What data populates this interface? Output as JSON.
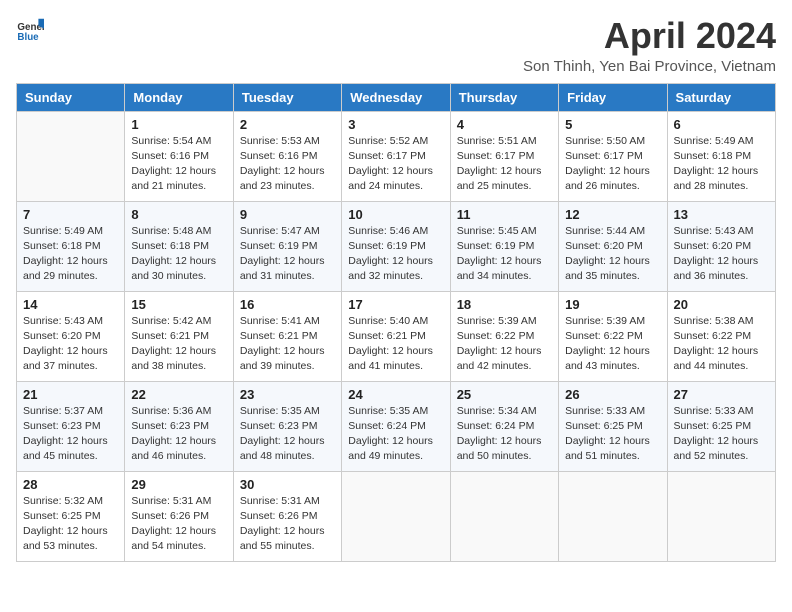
{
  "logo": {
    "line1": "General",
    "line2": "Blue"
  },
  "title": "April 2024",
  "subtitle": "Son Thinh, Yen Bai Province, Vietnam",
  "days_of_week": [
    "Sunday",
    "Monday",
    "Tuesday",
    "Wednesday",
    "Thursday",
    "Friday",
    "Saturday"
  ],
  "weeks": [
    [
      {
        "day": "",
        "info": ""
      },
      {
        "day": "1",
        "info": "Sunrise: 5:54 AM\nSunset: 6:16 PM\nDaylight: 12 hours and 21 minutes."
      },
      {
        "day": "2",
        "info": "Sunrise: 5:53 AM\nSunset: 6:16 PM\nDaylight: 12 hours and 23 minutes."
      },
      {
        "day": "3",
        "info": "Sunrise: 5:52 AM\nSunset: 6:17 PM\nDaylight: 12 hours and 24 minutes."
      },
      {
        "day": "4",
        "info": "Sunrise: 5:51 AM\nSunset: 6:17 PM\nDaylight: 12 hours and 25 minutes."
      },
      {
        "day": "5",
        "info": "Sunrise: 5:50 AM\nSunset: 6:17 PM\nDaylight: 12 hours and 26 minutes."
      },
      {
        "day": "6",
        "info": "Sunrise: 5:49 AM\nSunset: 6:18 PM\nDaylight: 12 hours and 28 minutes."
      }
    ],
    [
      {
        "day": "7",
        "info": "Sunrise: 5:49 AM\nSunset: 6:18 PM\nDaylight: 12 hours and 29 minutes."
      },
      {
        "day": "8",
        "info": "Sunrise: 5:48 AM\nSunset: 6:18 PM\nDaylight: 12 hours and 30 minutes."
      },
      {
        "day": "9",
        "info": "Sunrise: 5:47 AM\nSunset: 6:19 PM\nDaylight: 12 hours and 31 minutes."
      },
      {
        "day": "10",
        "info": "Sunrise: 5:46 AM\nSunset: 6:19 PM\nDaylight: 12 hours and 32 minutes."
      },
      {
        "day": "11",
        "info": "Sunrise: 5:45 AM\nSunset: 6:19 PM\nDaylight: 12 hours and 34 minutes."
      },
      {
        "day": "12",
        "info": "Sunrise: 5:44 AM\nSunset: 6:20 PM\nDaylight: 12 hours and 35 minutes."
      },
      {
        "day": "13",
        "info": "Sunrise: 5:43 AM\nSunset: 6:20 PM\nDaylight: 12 hours and 36 minutes."
      }
    ],
    [
      {
        "day": "14",
        "info": "Sunrise: 5:43 AM\nSunset: 6:20 PM\nDaylight: 12 hours and 37 minutes."
      },
      {
        "day": "15",
        "info": "Sunrise: 5:42 AM\nSunset: 6:21 PM\nDaylight: 12 hours and 38 minutes."
      },
      {
        "day": "16",
        "info": "Sunrise: 5:41 AM\nSunset: 6:21 PM\nDaylight: 12 hours and 39 minutes."
      },
      {
        "day": "17",
        "info": "Sunrise: 5:40 AM\nSunset: 6:21 PM\nDaylight: 12 hours and 41 minutes."
      },
      {
        "day": "18",
        "info": "Sunrise: 5:39 AM\nSunset: 6:22 PM\nDaylight: 12 hours and 42 minutes."
      },
      {
        "day": "19",
        "info": "Sunrise: 5:39 AM\nSunset: 6:22 PM\nDaylight: 12 hours and 43 minutes."
      },
      {
        "day": "20",
        "info": "Sunrise: 5:38 AM\nSunset: 6:22 PM\nDaylight: 12 hours and 44 minutes."
      }
    ],
    [
      {
        "day": "21",
        "info": "Sunrise: 5:37 AM\nSunset: 6:23 PM\nDaylight: 12 hours and 45 minutes."
      },
      {
        "day": "22",
        "info": "Sunrise: 5:36 AM\nSunset: 6:23 PM\nDaylight: 12 hours and 46 minutes."
      },
      {
        "day": "23",
        "info": "Sunrise: 5:35 AM\nSunset: 6:23 PM\nDaylight: 12 hours and 48 minutes."
      },
      {
        "day": "24",
        "info": "Sunrise: 5:35 AM\nSunset: 6:24 PM\nDaylight: 12 hours and 49 minutes."
      },
      {
        "day": "25",
        "info": "Sunrise: 5:34 AM\nSunset: 6:24 PM\nDaylight: 12 hours and 50 minutes."
      },
      {
        "day": "26",
        "info": "Sunrise: 5:33 AM\nSunset: 6:25 PM\nDaylight: 12 hours and 51 minutes."
      },
      {
        "day": "27",
        "info": "Sunrise: 5:33 AM\nSunset: 6:25 PM\nDaylight: 12 hours and 52 minutes."
      }
    ],
    [
      {
        "day": "28",
        "info": "Sunrise: 5:32 AM\nSunset: 6:25 PM\nDaylight: 12 hours and 53 minutes."
      },
      {
        "day": "29",
        "info": "Sunrise: 5:31 AM\nSunset: 6:26 PM\nDaylight: 12 hours and 54 minutes."
      },
      {
        "day": "30",
        "info": "Sunrise: 5:31 AM\nSunset: 6:26 PM\nDaylight: 12 hours and 55 minutes."
      },
      {
        "day": "",
        "info": ""
      },
      {
        "day": "",
        "info": ""
      },
      {
        "day": "",
        "info": ""
      },
      {
        "day": "",
        "info": ""
      }
    ]
  ]
}
